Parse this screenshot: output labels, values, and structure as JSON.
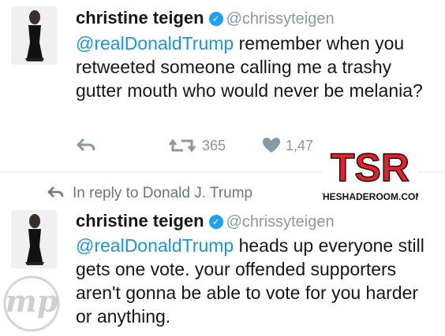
{
  "tweets": [
    {
      "name": "christine teigen",
      "handle": "@chrissyteigen",
      "mention": "@realDonaldTrump",
      "text": " remember when you retweeted someone calling me a trashy gutter mouth who would never be melania?",
      "actions": {
        "retweets": "365",
        "likes": "1,47"
      }
    },
    {
      "reply_to": "In reply to Donald J. Trump",
      "name": "christine teigen",
      "handle": "@chrissyteigen",
      "mention": "@realDonaldTrump",
      "text": " heads up everyone still gets one vote. your offended supporters aren't gonna be able to vote for you harder or anything."
    }
  ],
  "watermarks": {
    "tsr_logo": "TSR",
    "tsr_site": "THESHADEROOM.COM",
    "mp_logo": "mp"
  },
  "icons": {
    "reply": "reply-arrow-icon",
    "retweet": "retweet-icon",
    "like": "heart-icon",
    "verified": "verified-badge-icon"
  },
  "colors": {
    "link": "#1b95e0",
    "muted": "#8899a6",
    "verified": "#1da1f2",
    "tsr_red": "#e8202a"
  }
}
